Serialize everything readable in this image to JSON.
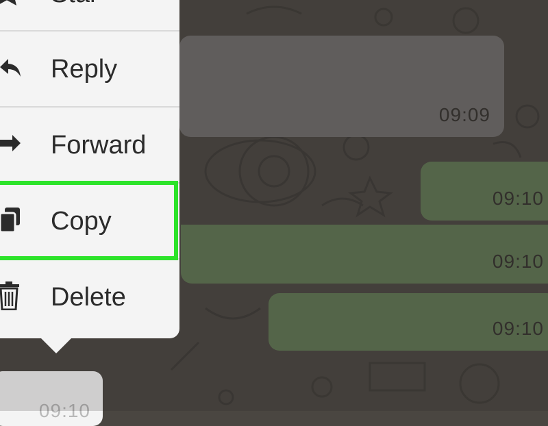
{
  "menu": {
    "items": [
      {
        "label": "Star",
        "icon": "star-icon"
      },
      {
        "label": "Reply",
        "icon": "reply-icon"
      },
      {
        "label": "Forward",
        "icon": "forward-icon"
      },
      {
        "label": "Copy",
        "icon": "copy-icon"
      },
      {
        "label": "Delete",
        "icon": "trash-icon"
      }
    ],
    "highlighted": "Copy",
    "highlight_color": "#2de32a"
  },
  "messages": [
    {
      "direction": "incoming",
      "time": "09:09"
    },
    {
      "direction": "outgoing",
      "time": "09:10"
    },
    {
      "direction": "outgoing",
      "time": "09:10"
    },
    {
      "direction": "outgoing",
      "time": "09:10"
    },
    {
      "direction": "incoming",
      "time": "09:10"
    }
  ],
  "colors": {
    "incoming_bubble": "#6d6b69",
    "outgoing_bubble": "#5f7552",
    "menu_background": "#f4f4f4",
    "wallpaper": "#4a4641"
  }
}
